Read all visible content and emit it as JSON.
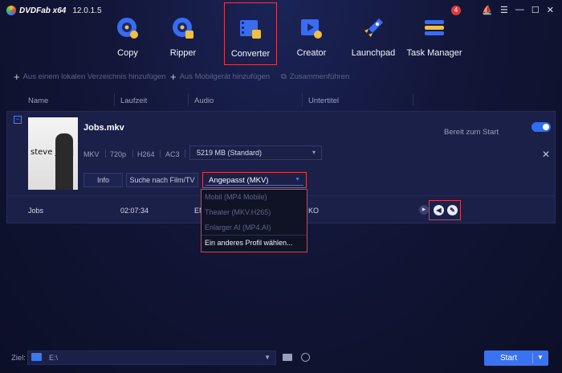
{
  "app": {
    "brand": "DVDFab x64",
    "version": "12.0.1.5",
    "notifications": "4",
    "window_controls": [
      "⛵",
      "☰",
      "—",
      "☐",
      "✕"
    ]
  },
  "modules": [
    {
      "label": "Copy",
      "icon": "copy-disc-icon"
    },
    {
      "label": "Ripper",
      "icon": "ripper-disc-icon"
    },
    {
      "label": "Converter",
      "icon": "converter-film-icon"
    },
    {
      "label": "Creator",
      "icon": "creator-film-icon"
    },
    {
      "label": "Launchpad",
      "icon": "rocket-icon"
    },
    {
      "label": "Task Manager",
      "icon": "task-stack-icon"
    }
  ],
  "subtoolbar": {
    "add_local": "Aus einem lokalen Verzeichnis hinzufügen",
    "add_mobile": "Aus Mobilgerät hinzufügen",
    "merge": "Zusammenführen"
  },
  "columns": {
    "name": "Name",
    "runtime": "Laufzeit",
    "audio": "Audio",
    "subtitle": "Untertitel"
  },
  "task": {
    "collapse": "−",
    "poster_text": "steve jobs|",
    "title": "Jobs.mkv",
    "status": "Bereit zum Start",
    "close": "✕",
    "meta": [
      "MKV",
      "720p",
      "H264",
      "AC3"
    ],
    "size_option": "5219 MB (Standard)",
    "info_button": "Info",
    "search_button": "Suche nach Film/TV",
    "profile_selected": "Angepasst (MKV)",
    "profile_options": [
      "Mobil (MP4 Mobile)",
      "Theater (MKV.H265)",
      "Enlarger AI (MP4.AI)",
      "Ein anderes Profil wählen..."
    ]
  },
  "track": {
    "name": "Jobs",
    "runtime": "02:07:34",
    "audio": "EN",
    "subtitle": "KO"
  },
  "bottom": {
    "dest_label": "Ziel:",
    "dest_value": "E:\\",
    "start": "Start"
  },
  "colors": {
    "accent": "#3a72f2",
    "highlight": "#e0404a",
    "background": "#121638"
  }
}
